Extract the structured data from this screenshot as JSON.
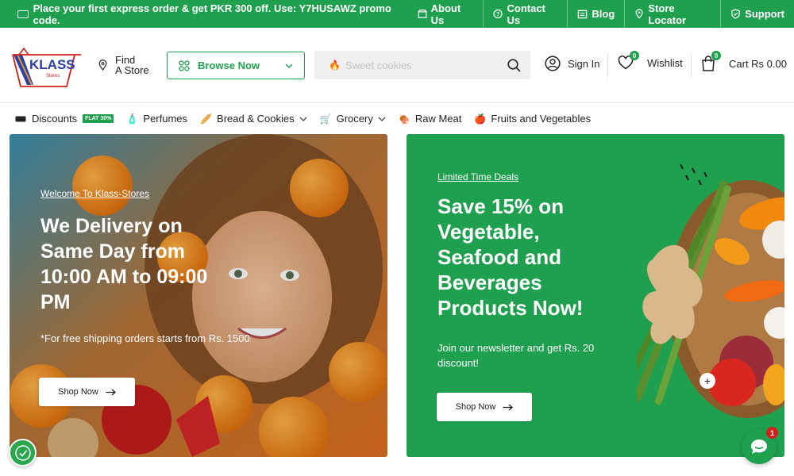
{
  "topbar": {
    "promo": "Place your first express order & get PKR 300 off. Use: Y7HUSAWZ promo code.",
    "links": [
      "About Us",
      "Contact Us",
      "Blog",
      "Store Locator",
      "Support"
    ]
  },
  "header": {
    "logo_text": "KLASS",
    "logo_sub": "Stores",
    "find_store": [
      "Find",
      "A Store"
    ],
    "browse_label": "Browse Now",
    "search_placeholder": "Sweet cookies",
    "sign_in": "Sign In",
    "wishlist": "Wishlist",
    "wishlist_count": "0",
    "cart": "Cart Rs 0.00",
    "cart_count": "0"
  },
  "nav": {
    "items": [
      {
        "label": "Discounts",
        "badge": "FLAT 30%"
      },
      {
        "label": "Perfumes"
      },
      {
        "label": "Bread & Cookies"
      },
      {
        "label": "Grocery"
      },
      {
        "label": "Raw Meat"
      },
      {
        "label": "Fruits and Vegetables"
      }
    ]
  },
  "hero_left": {
    "kicker": "Welcome To Klass-Stores",
    "headline": "We Delivery on Same Day from 10:00 AM to 09:00 PM",
    "note": "*For free shipping orders starts from Rs. 1500",
    "button": "Shop Now"
  },
  "hero_right": {
    "kicker": "Limited Time Deals",
    "headline": "Save 15% on Vegetable, Seafood and Beverages Products Now!",
    "sub": "Join our newsletter and get Rs. 20 discount!",
    "button": "Shop Now"
  },
  "chat": {
    "count": "1"
  },
  "colors": {
    "brand": "#1fa04f",
    "alert": "#d4201c"
  }
}
